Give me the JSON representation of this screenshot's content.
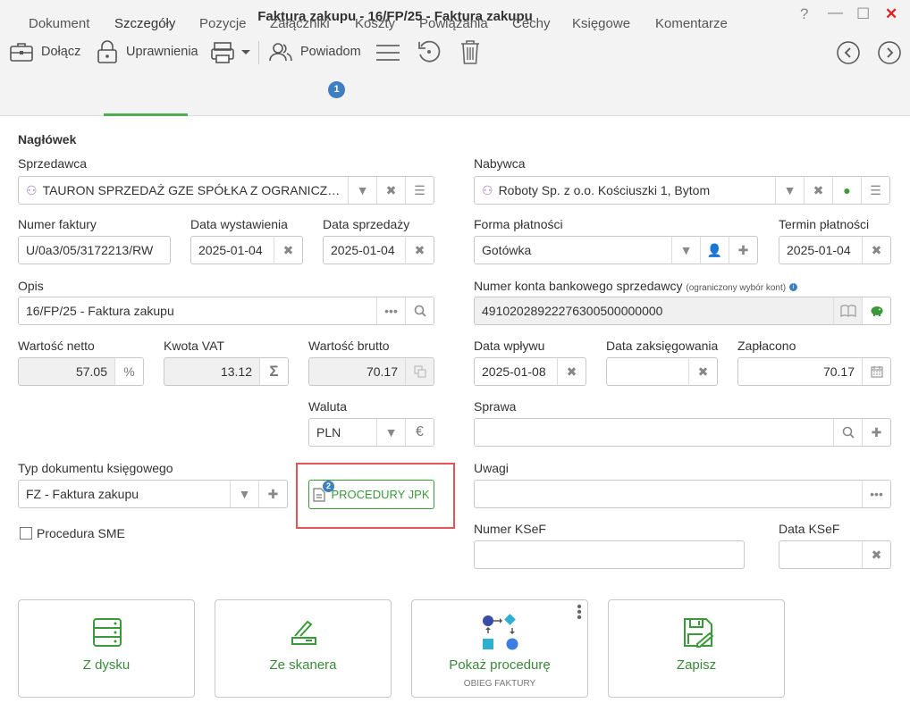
{
  "window": {
    "title": "Faktura zakupu - 16/FP/25 - Faktura zakupu",
    "help": "?",
    "minimize": "—",
    "maximize": "☐",
    "close": "✕"
  },
  "toolbar": {
    "attach": "Dołącz",
    "permissions": "Uprawnienia",
    "notify": "Powiadom"
  },
  "tabs": [
    {
      "label": "Dokument"
    },
    {
      "label": "Szczegóły"
    },
    {
      "label": "Pozycje"
    },
    {
      "label": "Załączniki",
      "badge": "1"
    },
    {
      "label": "Koszty"
    },
    {
      "label": "Powiązania"
    },
    {
      "label": "Cechy"
    },
    {
      "label": "Księgowe"
    },
    {
      "label": "Komentarze"
    }
  ],
  "form": {
    "header": "Nagłówek",
    "seller": {
      "label": "Sprzedawca",
      "value": "TAURON SPRZEDAŻ GZE SPÓŁKA Z OGRANICZO..."
    },
    "buyer": {
      "label": "Nabywca",
      "value": "Roboty Sp. z o.o. Kościuszki 1, Bytom"
    },
    "invoice_no": {
      "label": "Numer faktury",
      "value": "U/0a3/05/3172213/RW"
    },
    "issue_date": {
      "label": "Data wystawienia",
      "value": "2025-01-04"
    },
    "sale_date": {
      "label": "Data sprzedaży",
      "value": "2025-01-04"
    },
    "payment_form": {
      "label": "Forma płatności",
      "value": "Gotówka"
    },
    "payment_term": {
      "label": "Termin płatności",
      "value": "2025-01-04"
    },
    "description": {
      "label": "Opis",
      "value": "16/FP/25 - Faktura zakupu"
    },
    "bank_account": {
      "label": "Numer konta bankowego sprzedawcy",
      "note": "(ograniczony wybór kont)",
      "value": "49102028922276300500000000"
    },
    "net": {
      "label": "Wartość netto",
      "value": "57.05",
      "btn": "%"
    },
    "vat": {
      "label": "Kwota VAT",
      "value": "13.12",
      "btn": "Σ"
    },
    "gross": {
      "label": "Wartość brutto",
      "value": "70.17"
    },
    "receipt_date": {
      "label": "Data wpływu",
      "value": "2025-01-08"
    },
    "booking_date": {
      "label": "Data zaksięgowania",
      "value": ""
    },
    "paid": {
      "label": "Zapłacono",
      "value": "70.17"
    },
    "currency": {
      "label": "Waluta",
      "value": "PLN",
      "btn": "€"
    },
    "case": {
      "label": "Sprawa",
      "value": ""
    },
    "doc_type": {
      "label": "Typ dokumentu księgowego",
      "value": "FZ - Faktura zakupu"
    },
    "jpk": {
      "label": "PROCEDURY JPK",
      "badge": "2"
    },
    "notes": {
      "label": "Uwagi",
      "value": ""
    },
    "sme": {
      "label": "Procedura SME"
    },
    "ksef_no": {
      "label": "Numer KSeF",
      "value": ""
    },
    "ksef_date": {
      "label": "Data KSeF",
      "value": ""
    }
  },
  "actions": {
    "from_disk": "Z dysku",
    "from_scanner": "Ze skanera",
    "show_procedure": "Pokaż procedurę",
    "procedure_sub": "OBIEG FAKTURY",
    "save": "Zapisz"
  },
  "colors": {
    "accent": "#4caf50",
    "badge": "#3d7fbf",
    "highlight": "#e05555"
  }
}
